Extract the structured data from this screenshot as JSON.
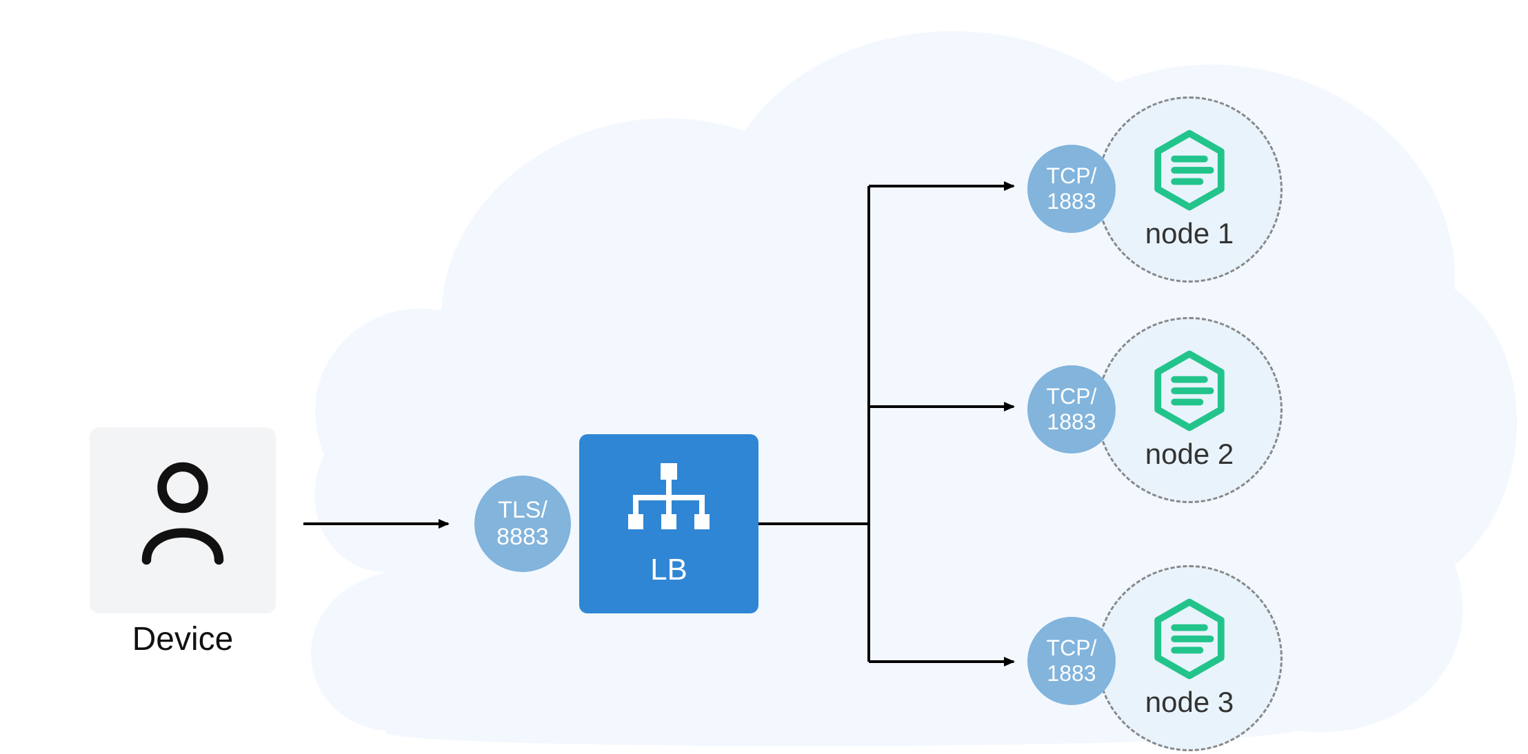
{
  "device": {
    "label": "Device"
  },
  "lb": {
    "label": "LB",
    "incoming_port": {
      "proto": "TLS/",
      "port": "8883"
    }
  },
  "nodes": [
    {
      "label": "node 1",
      "port": {
        "proto": "TCP/",
        "port": "1883"
      }
    },
    {
      "label": "node 2",
      "port": {
        "proto": "TCP/",
        "port": "1883"
      }
    },
    {
      "label": "node 3",
      "port": {
        "proto": "TCP/",
        "port": "1883"
      }
    }
  ],
  "colors": {
    "cloud": "#f3f8fe",
    "device_bg": "#f3f4f6",
    "port_circle": "#82b4dc",
    "lb_bg": "#2f86d4",
    "node_bg": "#e9f3fb",
    "node_border": "#888888",
    "hex_stroke": "#23c48c",
    "arrow": "#000000"
  }
}
